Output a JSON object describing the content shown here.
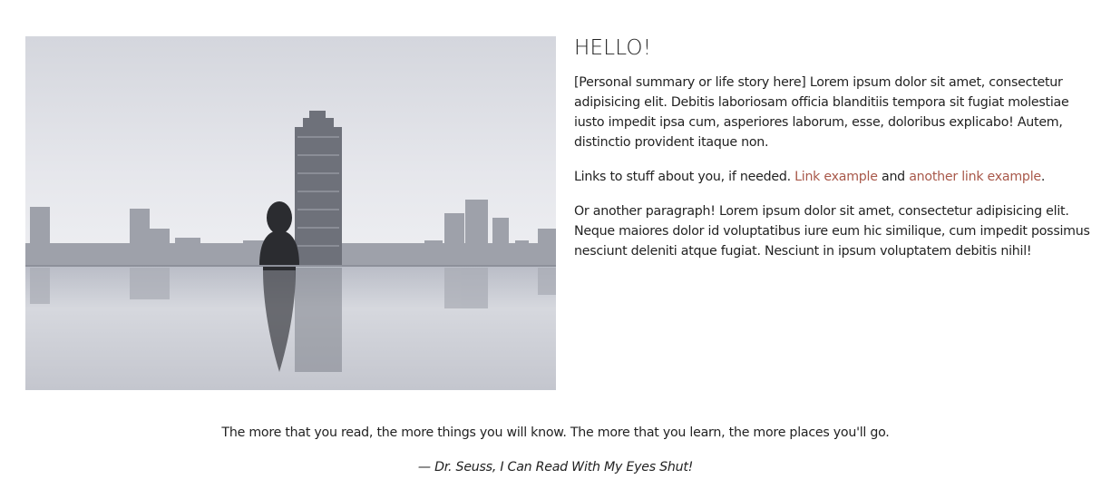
{
  "intro": {
    "heading": "HELLO!",
    "summary": "[Personal summary or life story here] Lorem ipsum dolor sit amet, consectetur adipisicing elit. Debitis laboriosam officia blanditiis tempora sit fugiat molestiae iusto impedit ipsa cum, asperiores laborum, esse, doloribus explicabo! Autem, distinctio provident itaque non.",
    "links_lead": "Links to stuff about you, if needed. ",
    "link1": "Link example",
    "links_middle": " and ",
    "link2": "another link example",
    "links_end": ".",
    "paragraph2": "Or another paragraph! Lorem ipsum dolor sit amet, consectetur adipisicing elit. Neque maiores dolor id voluptatibus iure eum hic similique, cum impedit possimus nesciunt deleniti atque fugiat. Nesciunt in ipsum voluptatem debitis nihil!"
  },
  "quote": {
    "text": "The more that you read, the more things you will know. The more that you learn, the more places you'll go.",
    "citation": "— Dr. Seuss, I Can Read With My Eyes Shut!"
  },
  "colors": {
    "link": "#a8584a",
    "text": "#222222"
  }
}
